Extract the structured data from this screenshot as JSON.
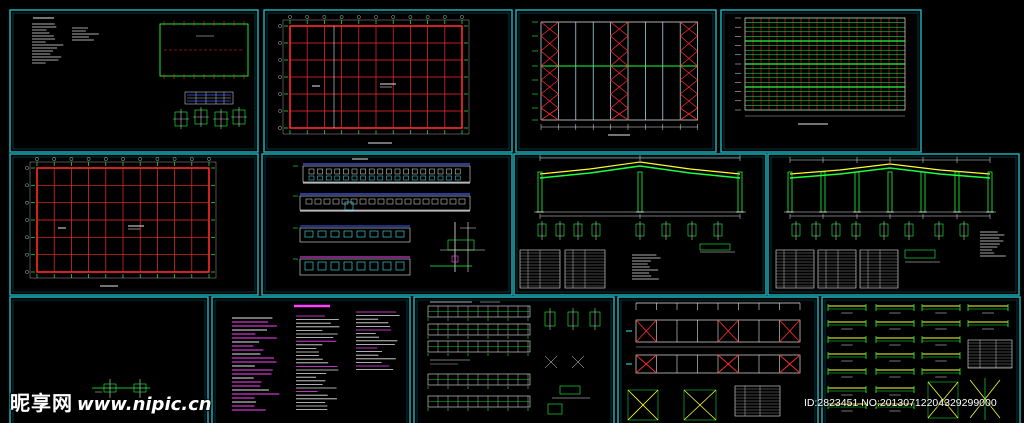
{
  "sheet": {
    "background": "#000000",
    "frame_color": "#1cb8c4",
    "frame_inner": "#0c5a62"
  },
  "colors": {
    "red": "#ff2a2a",
    "green": "#1cff3e",
    "white": "#e6e6e6",
    "yellow": "#ffff30",
    "magenta": "#ff44ff",
    "blue": "#3c5cff",
    "cyan": "#3ee8f0",
    "pale_cyan": "#b8f4ff"
  },
  "watermark": {
    "brand": "昵享网",
    "site": "www.nipic.cn"
  },
  "stamp": {
    "text": "ID:2823451 NO:20130712204329299000"
  }
}
